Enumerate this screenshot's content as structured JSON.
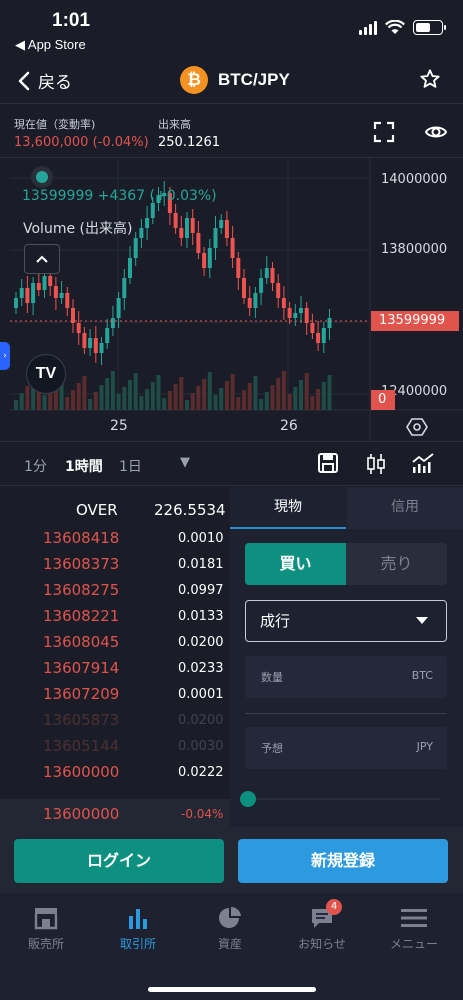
{
  "status_bar": {
    "time": "1:01",
    "back_app": "◀ App Store"
  },
  "nav": {
    "back_label": "戻る",
    "pair": "BTC/JPY",
    "coin_symbol": "₿"
  },
  "info": {
    "price_label": "現在値（変動率)",
    "price_value": "13,600,000 (-0.04%)",
    "volume_label": "出来高",
    "volume_value": "250.1261"
  },
  "chart": {
    "legend_text": "13599999 +4367 (+0.03%)",
    "volume_label": "Volume (出来高)",
    "tv_logo": "TV",
    "y_labels": [
      "14000000",
      "13800000",
      "12400000"
    ],
    "price_tag": "13599999",
    "zero_tag": "0",
    "x_labels": [
      "25",
      "26"
    ]
  },
  "chart_data": {
    "type": "candlestick",
    "last_price": 13599999,
    "change": 4367,
    "change_pct": 0.03,
    "y_ticks": [
      14000000,
      13800000
    ],
    "x_ticks": [
      "25",
      "26"
    ],
    "colors": {
      "up": "#26a69a",
      "down": "#ef5350"
    }
  },
  "intervals": {
    "items": [
      "1分",
      "1時間",
      "1日"
    ],
    "active": "1時間"
  },
  "orderbook": {
    "header_label": "OVER",
    "header_value": "226.5534",
    "asks": [
      {
        "price": "13608418",
        "qty": "0.0010"
      },
      {
        "price": "13608373",
        "qty": "0.0181"
      },
      {
        "price": "13608275",
        "qty": "0.0997"
      },
      {
        "price": "13608221",
        "qty": "0.0133"
      },
      {
        "price": "13608045",
        "qty": "0.0200"
      },
      {
        "price": "13607914",
        "qty": "0.0233"
      },
      {
        "price": "13607209",
        "qty": "0.0001"
      },
      {
        "price": "13605873",
        "qty": "0.0200"
      },
      {
        "price": "13605144",
        "qty": "0.0030"
      },
      {
        "price": "13600000",
        "qty": "0.0222"
      }
    ],
    "current_price": "13600000",
    "current_change": "-0.04%"
  },
  "trade": {
    "tab_spot": "現物",
    "tab_margin": "信用",
    "buy_label": "買い",
    "sell_label": "売り",
    "order_type": "成行",
    "qty_label": "数量",
    "qty_unit": "BTC",
    "est_label": "予想",
    "est_unit": "JPY"
  },
  "auth": {
    "login": "ログイン",
    "signup": "新規登録"
  },
  "tabbar": {
    "items": [
      {
        "label": "販売所"
      },
      {
        "label": "取引所"
      },
      {
        "label": "資産"
      },
      {
        "label": "お知らせ",
        "badge": "4"
      },
      {
        "label": "メニュー"
      }
    ]
  }
}
